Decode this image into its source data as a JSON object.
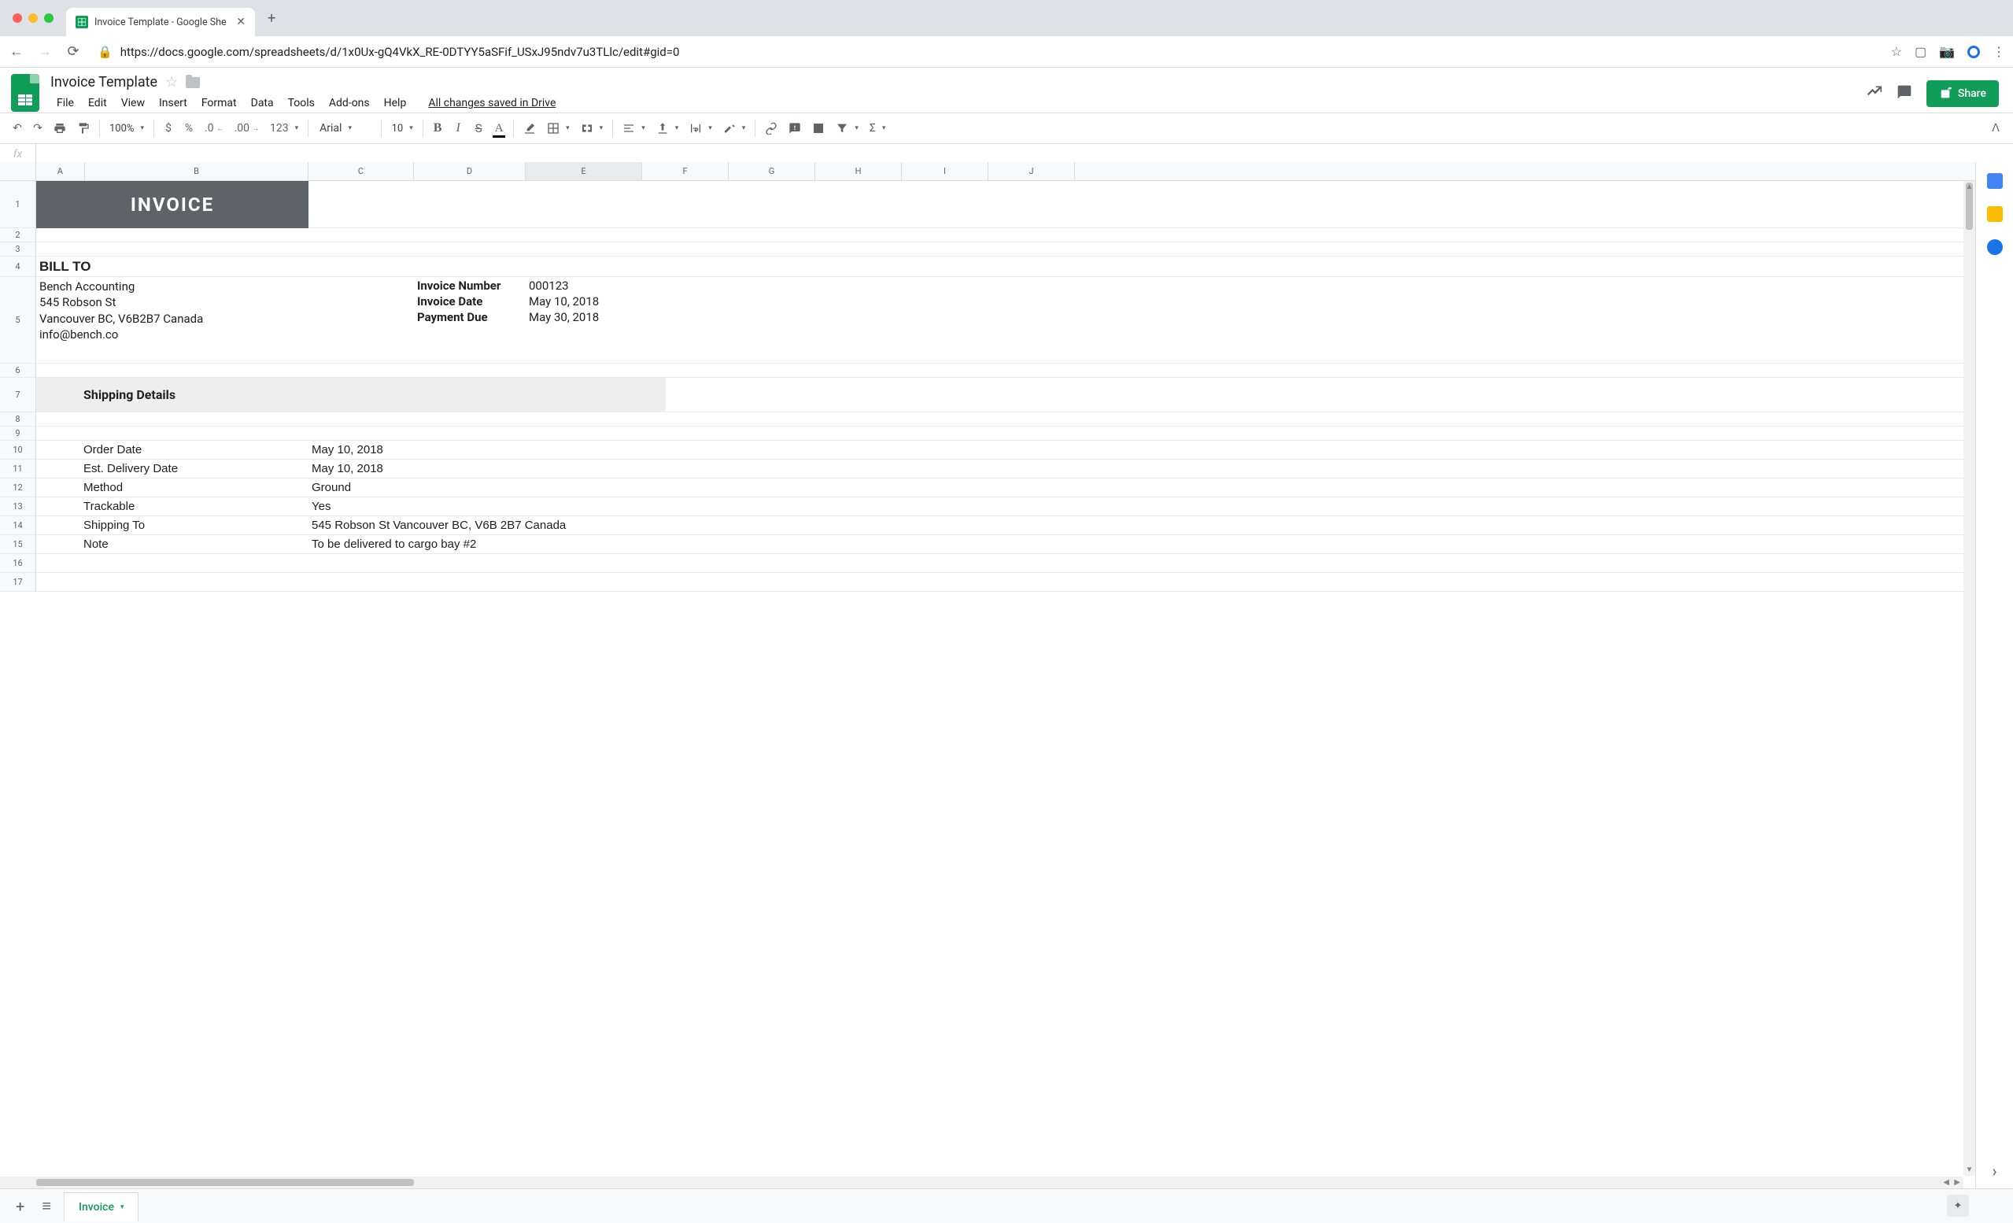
{
  "browser": {
    "tab_title": "Invoice Template - Google She",
    "url": "https://docs.google.com/spreadsheets/d/1x0Ux-gQ4VkX_RE-0DTYY5aSFif_USxJ95ndv7u3TLlc/edit#gid=0"
  },
  "doc": {
    "title": "Invoice Template",
    "save_status": "All changes saved in Drive",
    "share_label": "Share"
  },
  "menubar": [
    "File",
    "Edit",
    "View",
    "Insert",
    "Format",
    "Data",
    "Tools",
    "Add-ons",
    "Help"
  ],
  "toolbar": {
    "zoom": "100%",
    "font": "Arial",
    "size": "10",
    "number_fmt": "123"
  },
  "columns": [
    "A",
    "B",
    "C",
    "D",
    "E",
    "F",
    "G",
    "H",
    "I",
    "J"
  ],
  "rownums": [
    "1",
    "2",
    "3",
    "4",
    "5",
    "6",
    "7",
    "8",
    "9",
    "10",
    "11",
    "12",
    "13",
    "14",
    "15",
    "16",
    "17"
  ],
  "invoice": {
    "heading": "INVOICE",
    "bill_to_label": "BILL TO",
    "bill_to": "Bench Accounting\n545 Robson St\nVancouver BC, V6B2B7 Canada\ninfo@bench.co",
    "meta": {
      "inv_num_label": "Invoice Number",
      "inv_num": "000123",
      "inv_date_label": "Invoice Date",
      "inv_date": "May 10, 2018",
      "pay_due_label": "Payment Due",
      "pay_due": "May 30, 2018"
    },
    "shipping_header": "Shipping Details",
    "shipping": [
      {
        "label": "Order Date",
        "value": "May 10, 2018"
      },
      {
        "label": "Est. Delivery Date",
        "value": "May 10, 2018"
      },
      {
        "label": "Method",
        "value": "Ground"
      },
      {
        "label": "Trackable",
        "value": "Yes"
      },
      {
        "label": "Shipping To",
        "value": "545 Robson St Vancouver BC, V6B 2B7 Canada"
      },
      {
        "label": "Note",
        "value": "To be delivered to cargo bay #2"
      }
    ]
  },
  "sheet_tab": "Invoice",
  "fx_label": "fx"
}
